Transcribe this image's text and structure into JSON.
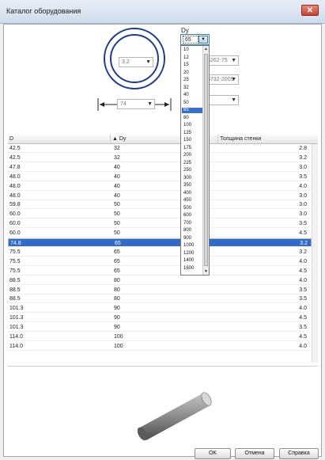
{
  "window": {
    "title": "Каталог оборудования",
    "close_glyph": "✕"
  },
  "diagram": {
    "inner_value": "3,2",
    "width_value": "74",
    "dy_label": "Dy",
    "dy_value": "65",
    "std_value": "3262-75",
    "std2_value": "8732-2009"
  },
  "dy_options": [
    "10",
    "12",
    "15",
    "20",
    "25",
    "32",
    "40",
    "50",
    "65",
    "80",
    "100",
    "125",
    "150",
    "175",
    "200",
    "225",
    "250",
    "300",
    "350",
    "400",
    "450",
    "500",
    "600",
    "700",
    "800",
    "900",
    "1000",
    "1200",
    "1400",
    "1600"
  ],
  "dy_selected_index": 8,
  "table": {
    "columns": [
      "D",
      "Dy",
      "Толщина стенки"
    ],
    "rows": [
      {
        "d": "42.5",
        "dy": "32",
        "t": "2.8"
      },
      {
        "d": "42.5",
        "dy": "32",
        "t": "3.2"
      },
      {
        "d": "47.8",
        "dy": "40",
        "t": "3.0"
      },
      {
        "d": "48.0",
        "dy": "40",
        "t": "3.5"
      },
      {
        "d": "48.0",
        "dy": "40",
        "t": "4.0"
      },
      {
        "d": "48.0",
        "dy": "40",
        "t": "3.0"
      },
      {
        "d": "59.8",
        "dy": "50",
        "t": "3.0"
      },
      {
        "d": "60.0",
        "dy": "50",
        "t": "3.0"
      },
      {
        "d": "60.0",
        "dy": "50",
        "t": "3.5"
      },
      {
        "d": "60.0",
        "dy": "50",
        "t": "4.5"
      },
      {
        "d": "74.8",
        "dy": "65",
        "t": "3.2"
      },
      {
        "d": "75.5",
        "dy": "65",
        "t": "3.2"
      },
      {
        "d": "75.5",
        "dy": "65",
        "t": "4.0"
      },
      {
        "d": "75.5",
        "dy": "65",
        "t": "4.5"
      },
      {
        "d": "88.5",
        "dy": "80",
        "t": "4.0"
      },
      {
        "d": "88.5",
        "dy": "80",
        "t": "3.5"
      },
      {
        "d": "88.5",
        "dy": "80",
        "t": "3.5"
      },
      {
        "d": "101.3",
        "dy": "90",
        "t": "4.0"
      },
      {
        "d": "101.3",
        "dy": "90",
        "t": "4.5"
      },
      {
        "d": "101.3",
        "dy": "90",
        "t": "3.5"
      },
      {
        "d": "114.0",
        "dy": "100",
        "t": "4.5"
      },
      {
        "d": "114.0",
        "dy": "100",
        "t": "4.0"
      }
    ],
    "selected_row": 10
  },
  "buttons": {
    "ok": "OK",
    "cancel": "Отмена",
    "help": "Справка"
  },
  "colors": {
    "accent": "#2f6bc7",
    "pipe": "#8a8a8a"
  }
}
